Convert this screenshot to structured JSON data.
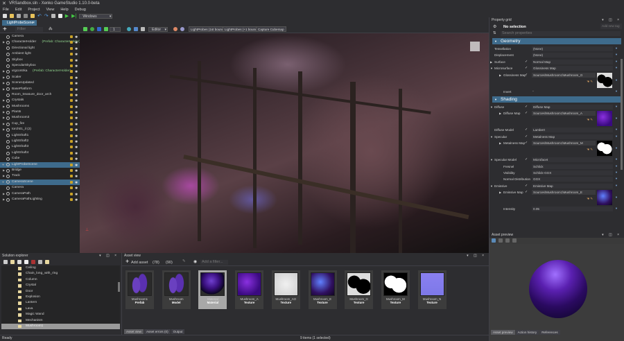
{
  "window": {
    "title": "VRSandbox.sln - Xenko GameStudio 1.10.0-beta"
  },
  "menu": [
    "File",
    "Edit",
    "Project",
    "View",
    "Help",
    "Debug"
  ],
  "toolbar": {
    "platform": "Windows"
  },
  "doc_tab": {
    "label": "LightProbeScene"
  },
  "scene_toolbar": {
    "filter_placeholder": "Filter",
    "count": "1",
    "mode": "Editor",
    "buttons": [
      "LightProbes (1st bounce)",
      "LightProbes (+1 bounce)",
      "Capture Cubemap"
    ]
  },
  "scene_tree": [
    {
      "label": "Camera",
      "indent": 1,
      "arrow": false
    },
    {
      "label": "CharacterHolder",
      "prefab": "(Prefab: CharacterHolder)",
      "indent": 1,
      "arrow": true
    },
    {
      "label": "Directional light",
      "indent": 1,
      "arrow": false
    },
    {
      "label": "Ambient light",
      "indent": 1,
      "arrow": false
    },
    {
      "label": "Skybox",
      "indent": 1,
      "arrow": false
    },
    {
      "label": "SpecularSkybox",
      "indent": 1,
      "arrow": false
    },
    {
      "label": "vrgcontrka",
      "prefab": "(Prefab: CharacterHolder)",
      "indent": 1,
      "arrow": true
    },
    {
      "label": "Scaler",
      "indent": 1,
      "arrow": true
    },
    {
      "label": "SceneUpdated",
      "indent": 1,
      "arrow": true
    },
    {
      "label": "BasePlatform",
      "indent": 1,
      "arrow": true
    },
    {
      "label": "Room_treasure_door_arch",
      "indent": 1,
      "arrow": false
    },
    {
      "label": "Crystals",
      "indent": 1,
      "arrow": true
    },
    {
      "label": "Mushrooms",
      "indent": 1,
      "arrow": true
    },
    {
      "label": "Plants",
      "indent": 1,
      "arrow": true
    },
    {
      "label": "Mushroom3",
      "indent": 1,
      "arrow": true
    },
    {
      "label": "Cup_fire",
      "indent": 1,
      "arrow": true
    },
    {
      "label": "torch01_il (2)",
      "indent": 1,
      "arrow": true
    },
    {
      "label": "LightShaft1",
      "indent": 1,
      "arrow": false
    },
    {
      "label": "LightShaft2",
      "indent": 1,
      "arrow": false
    },
    {
      "label": "LightShaft3",
      "indent": 1,
      "arrow": false
    },
    {
      "label": "LightShaft4",
      "indent": 1,
      "arrow": false
    },
    {
      "label": "Cube",
      "indent": 1,
      "arrow": false
    },
    {
      "label": "LightProbeScene",
      "indent": 0,
      "arrow": true,
      "selected": true
    },
    {
      "label": "Bridge",
      "indent": 1,
      "arrow": true
    },
    {
      "label": "Track",
      "indent": 1,
      "arrow": true
    },
    {
      "label": "CameraScene",
      "indent": 0,
      "arrow": true,
      "selected": true
    },
    {
      "label": "Camera",
      "indent": 1,
      "arrow": false
    },
    {
      "label": "CameraPath",
      "indent": 1,
      "arrow": true
    },
    {
      "label": "CameraPathLighting",
      "indent": 1,
      "arrow": true
    }
  ],
  "property_grid": {
    "title": "Property grid",
    "selection": "No selection",
    "tag_placeholder": "Add new tag",
    "search_placeholder": "Search properties",
    "sections": [
      {
        "title": "Geometry",
        "rows": [
          {
            "label": "Tessellation",
            "value": "(None)"
          },
          {
            "label": "Displacement",
            "value": "(None)"
          },
          {
            "label": "Surface",
            "check": true,
            "value": "Normal Map",
            "arrow": true
          },
          {
            "label": "Microsurface",
            "check": true,
            "value": "Glossiness Map",
            "arrow": true,
            "open": true
          },
          {
            "label": "Glossiness Map",
            "check": true,
            "value": "Sources\\Mushroom1\\Mushroom_G",
            "sub": true,
            "thumb": "gloss"
          },
          {
            "label": "Invert",
            "value": "",
            "sub": true,
            "checkbox": true
          }
        ]
      },
      {
        "title": "Shading",
        "rows": [
          {
            "label": "Diffuse",
            "check": true,
            "value": "Diffuse Map",
            "open": true
          },
          {
            "label": "Diffuse Map",
            "check": true,
            "value": "Sources\\Mushroom1\\Mushroom_A",
            "sub": true,
            "thumb": "diffuse"
          },
          {
            "label": "Diffuse Model",
            "check": true,
            "value": "Lambert"
          },
          {
            "label": "Specular",
            "check": true,
            "value": "Metalness Map",
            "open": true
          },
          {
            "label": "Metalness Map",
            "check": true,
            "value": "Sources\\Mushroom1\\Mushroom_M",
            "sub": true,
            "thumb": "metal"
          },
          {
            "label": "Specular Model",
            "check": true,
            "value": "Microfacet",
            "open": true
          },
          {
            "label": "Fresnel",
            "value": "Schlick",
            "sub": true
          },
          {
            "label": "Visibility",
            "value": "Schlick-GGX",
            "sub": true
          },
          {
            "label": "Normal Distribution",
            "value": "GGX",
            "sub": true
          },
          {
            "label": "Emissive",
            "check": true,
            "value": "Emissive Map",
            "open": true
          },
          {
            "label": "Emissive Map",
            "check": true,
            "value": "Sources\\Mushroom1\\Mushroom_E",
            "sub": true,
            "thumb": "emissive"
          },
          {
            "label": "Intensity",
            "value": "0.05",
            "sub": true
          }
        ]
      }
    ]
  },
  "solution_explorer": {
    "title": "Solution explorer",
    "folders": [
      "Ceiling",
      "Chain_long_with_ring",
      "Column",
      "Crystal",
      "Door",
      "Explosion",
      "Lantern",
      "Lava",
      "Magic Wand",
      "Mechanism",
      "Mushroom1"
    ],
    "selected": "Mushroom1"
  },
  "asset_view": {
    "title": "Asset view",
    "add_label": "Add asset",
    "count1": "(78)",
    "count2": "(90)",
    "filter_placeholder": "Add a filter...",
    "assets": [
      {
        "name": "Mushroom1",
        "type": "Prefab",
        "thumb": "prefab"
      },
      {
        "name": "Mushroom",
        "type": "Model",
        "thumb": "prefab"
      },
      {
        "name": "Material",
        "type": "Material",
        "thumb": "material",
        "selected": true
      },
      {
        "name": "Mushroom_A",
        "type": "Texture",
        "thumb": "diffuse"
      },
      {
        "name": "Mushroom_AO",
        "type": "Texture",
        "thumb": "ao"
      },
      {
        "name": "Mushroom_E",
        "type": "Texture",
        "thumb": "emissive"
      },
      {
        "name": "Mushroom_G",
        "type": "Texture",
        "thumb": "gloss"
      },
      {
        "name": "Mushroom_M",
        "type": "Texture",
        "thumb": "metal"
      },
      {
        "name": "Mushroom_N",
        "type": "Texture",
        "thumb": "normal"
      }
    ],
    "tabs": [
      "Asset view",
      "Asset errors (0)",
      "Output"
    ],
    "status": "9 items (1 selected)"
  },
  "asset_preview": {
    "title": "Asset preview",
    "tabs": [
      "Asset preview",
      "Action history",
      "References"
    ]
  },
  "status": {
    "text": "Ready"
  },
  "colors": {
    "accent": "#3e6b8c",
    "background": "#2d2d30",
    "panel": "#252526"
  }
}
